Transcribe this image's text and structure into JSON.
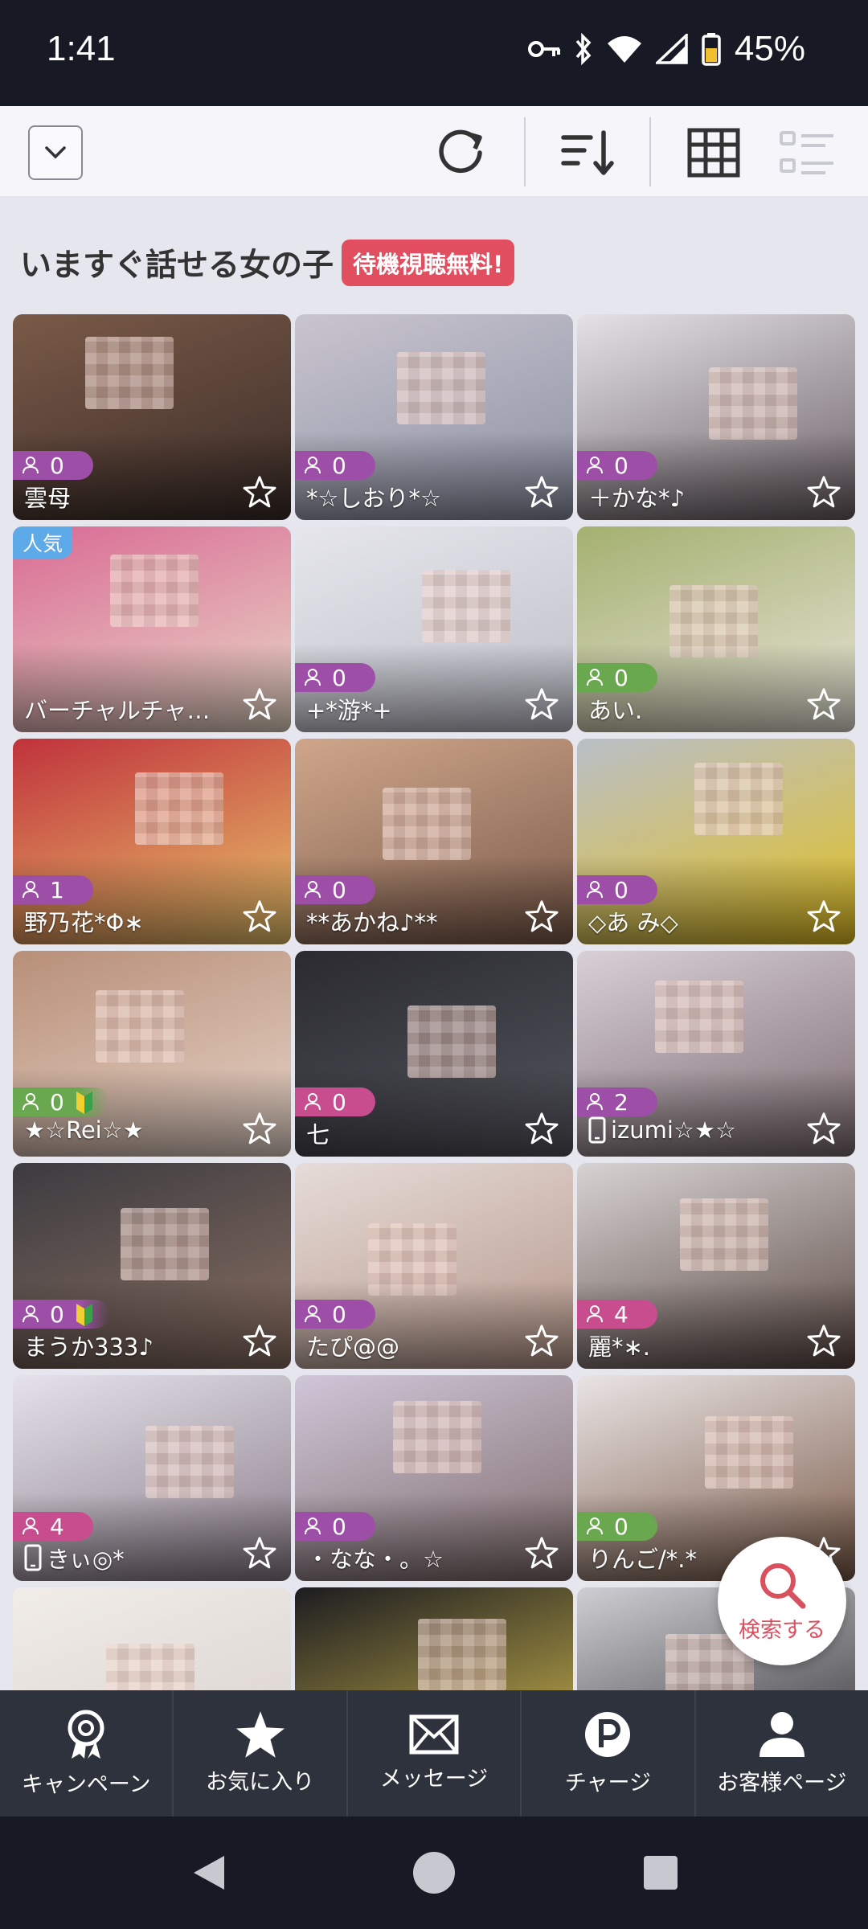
{
  "status_bar": {
    "time": "1:41",
    "battery": "45%"
  },
  "toolbar": {
    "dropdown_icon": "chevron-down-icon",
    "refresh_icon": "refresh-icon",
    "sort_icon": "sort-icon",
    "grid_view_icon": "grid-icon",
    "list_view_icon": "list-icon"
  },
  "section": {
    "title": "いますぐ話せる女の子",
    "badge": "待機視聴無料!"
  },
  "colors": {
    "accent": "#e14e60",
    "pill_purple": "#9d4fa8",
    "pill_green": "#6aa84f",
    "pill_pink": "#c84d8f",
    "popular_blue": "#5ea9e8",
    "nav_bg": "#2e323d"
  },
  "cards": [
    {
      "name": "雲母",
      "viewers": "0",
      "pill": "purple",
      "device": "",
      "popular": "",
      "beginner": false,
      "bg": [
        "#7a5a48",
        "#3a2c28"
      ]
    },
    {
      "name": "*☆しおり*☆",
      "viewers": "0",
      "pill": "purple",
      "device": "",
      "popular": "",
      "beginner": false,
      "bg": [
        "#c9c5cf",
        "#8b8fa2"
      ]
    },
    {
      "name": "＋かな*♪",
      "viewers": "0",
      "pill": "purple",
      "device": "",
      "popular": "",
      "beginner": false,
      "bg": [
        "#e4e2e6",
        "#6a5f64"
      ]
    },
    {
      "name": "バーチャルチャ…",
      "viewers": "",
      "pill": "none",
      "device": "",
      "popular": "人気",
      "beginner": false,
      "bg": [
        "#d96a94",
        "#e9d9c7"
      ]
    },
    {
      "name": "+*游*+",
      "viewers": "0",
      "pill": "purple",
      "device": "",
      "popular": "",
      "beginner": false,
      "bg": [
        "#e6e6ec",
        "#bdbdc8"
      ]
    },
    {
      "name": "あい.",
      "viewers": "0",
      "pill": "green",
      "device": "",
      "popular": "",
      "beginner": false,
      "bg": [
        "#a4b070",
        "#e8e4d8"
      ]
    },
    {
      "name": "野乃花*Φ∗",
      "viewers": "1",
      "pill": "purple",
      "device": "",
      "popular": "",
      "beginner": false,
      "bg": [
        "#c0323c",
        "#e9c46a"
      ]
    },
    {
      "name": "**あかね♪**",
      "viewers": "0",
      "pill": "purple",
      "device": "",
      "popular": "",
      "beginner": false,
      "bg": [
        "#cfa68a",
        "#7a5a4a"
      ]
    },
    {
      "name": "◇あ み◇",
      "viewers": "0",
      "pill": "purple",
      "device": "",
      "popular": "",
      "beginner": false,
      "bg": [
        "#b9bfc8",
        "#e2c020"
      ]
    },
    {
      "name": "★☆Rei☆★",
      "viewers": "0",
      "pill": "green",
      "device": "",
      "popular": "",
      "beginner": true,
      "bg": [
        "#b88f78",
        "#e6d4c9"
      ]
    },
    {
      "name": "七",
      "viewers": "0",
      "pill": "pink",
      "device": "",
      "popular": "",
      "beginner": false,
      "bg": [
        "#2a2a30",
        "#55555e"
      ]
    },
    {
      "name": "izumi☆★☆",
      "viewers": "2",
      "pill": "purple",
      "device": "phone",
      "popular": "",
      "beginner": false,
      "bg": [
        "#d9cfd6",
        "#7a6b70"
      ]
    },
    {
      "name": "まうか333♪",
      "viewers": "0",
      "pill": "purple",
      "device": "",
      "popular": "",
      "beginner": true,
      "bg": [
        "#3c3b40",
        "#8a6f62"
      ]
    },
    {
      "name": "たぴ@@",
      "viewers": "0",
      "pill": "purple",
      "device": "",
      "popular": "",
      "beginner": false,
      "bg": [
        "#e6dcd8",
        "#b49588"
      ]
    },
    {
      "name": "麗*∗.",
      "viewers": "4",
      "pill": "pink",
      "device": "",
      "popular": "",
      "beginner": false,
      "bg": [
        "#d7d3d2",
        "#5a4844"
      ]
    },
    {
      "name": "きぃ◎*",
      "viewers": "4",
      "pill": "pink",
      "device": "phone",
      "popular": "",
      "beginner": false,
      "bg": [
        "#e4e2ea",
        "#8a7c88"
      ]
    },
    {
      "name": "・なな・。☆",
      "viewers": "0",
      "pill": "purple",
      "device": "",
      "popular": "",
      "beginner": false,
      "bg": [
        "#cfc6d8",
        "#7d6a6a"
      ]
    },
    {
      "name": "りんご/*.*",
      "viewers": "0",
      "pill": "green",
      "device": "",
      "popular": "",
      "beginner": false,
      "bg": [
        "#e9e4e4",
        "#7a5a48"
      ]
    },
    {
      "name": "",
      "viewers": "",
      "pill": "none",
      "device": "",
      "popular": "",
      "beginner": false,
      "bg": [
        "#f1ede9",
        "#d7cfcb"
      ]
    },
    {
      "name": "",
      "viewers": "",
      "pill": "none",
      "device": "",
      "popular": "",
      "beginner": false,
      "bg": [
        "#1c1c20",
        "#d8c050"
      ]
    },
    {
      "name": "",
      "viewers": "",
      "pill": "none",
      "device": "",
      "popular": "",
      "beginner": false,
      "bg": [
        "#cfcfd3",
        "#2a2a2e"
      ]
    }
  ],
  "search_fab": {
    "label": "検索する"
  },
  "bottom_nav": [
    {
      "label": "キャンペーン",
      "icon": "campaign-badge-icon"
    },
    {
      "label": "お気に入り",
      "icon": "star-icon"
    },
    {
      "label": "メッセージ",
      "icon": "envelope-icon"
    },
    {
      "label": "チャージ",
      "icon": "points-icon"
    },
    {
      "label": "お客様ページ",
      "icon": "user-icon"
    }
  ]
}
